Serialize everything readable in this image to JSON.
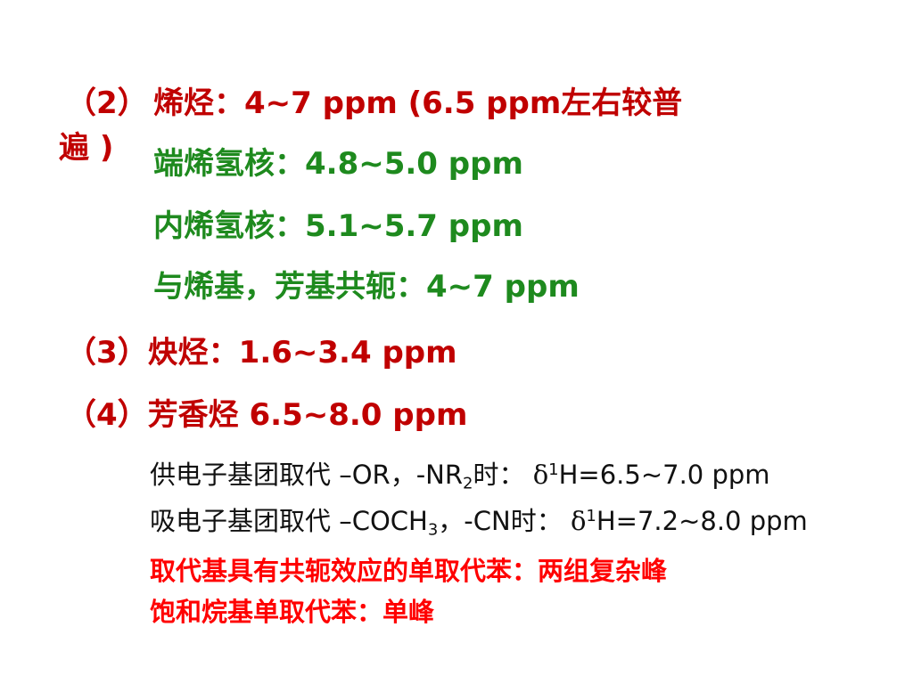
{
  "section2": {
    "num": "（2）",
    "heading": "烯烃：4~7 ppm (6.5 ppm左右较普",
    "heading_cont": "遍 )",
    "items": [
      "端烯氢核：4.8~5.0 ppm",
      "内烯氢核：5.1~5.7 ppm",
      "与烯基，芳基共轭：4~7 ppm"
    ]
  },
  "section3": {
    "text": "（3）炔烃：1.6~3.4 ppm"
  },
  "section4": {
    "text": "（4）芳香烃 6.5~8.0 ppm"
  },
  "donor": {
    "prefix": "供电子基团取代 –OR，-NR",
    "sub": "2",
    "mid": "时：",
    "delta": "δ",
    "sup": "1",
    "value": "H=6.5~7.0 ppm"
  },
  "acceptor": {
    "prefix": "吸电子基团取代 –COCH",
    "sub": "3",
    "mid": "，-CN时：",
    "delta": "δ",
    "sup": "1",
    "value": "H=7.2~8.0 ppm"
  },
  "conclusions": [
    "取代基具有共轭效应的单取代苯：两组复杂峰",
    "饱和烷基单取代苯：单峰"
  ]
}
